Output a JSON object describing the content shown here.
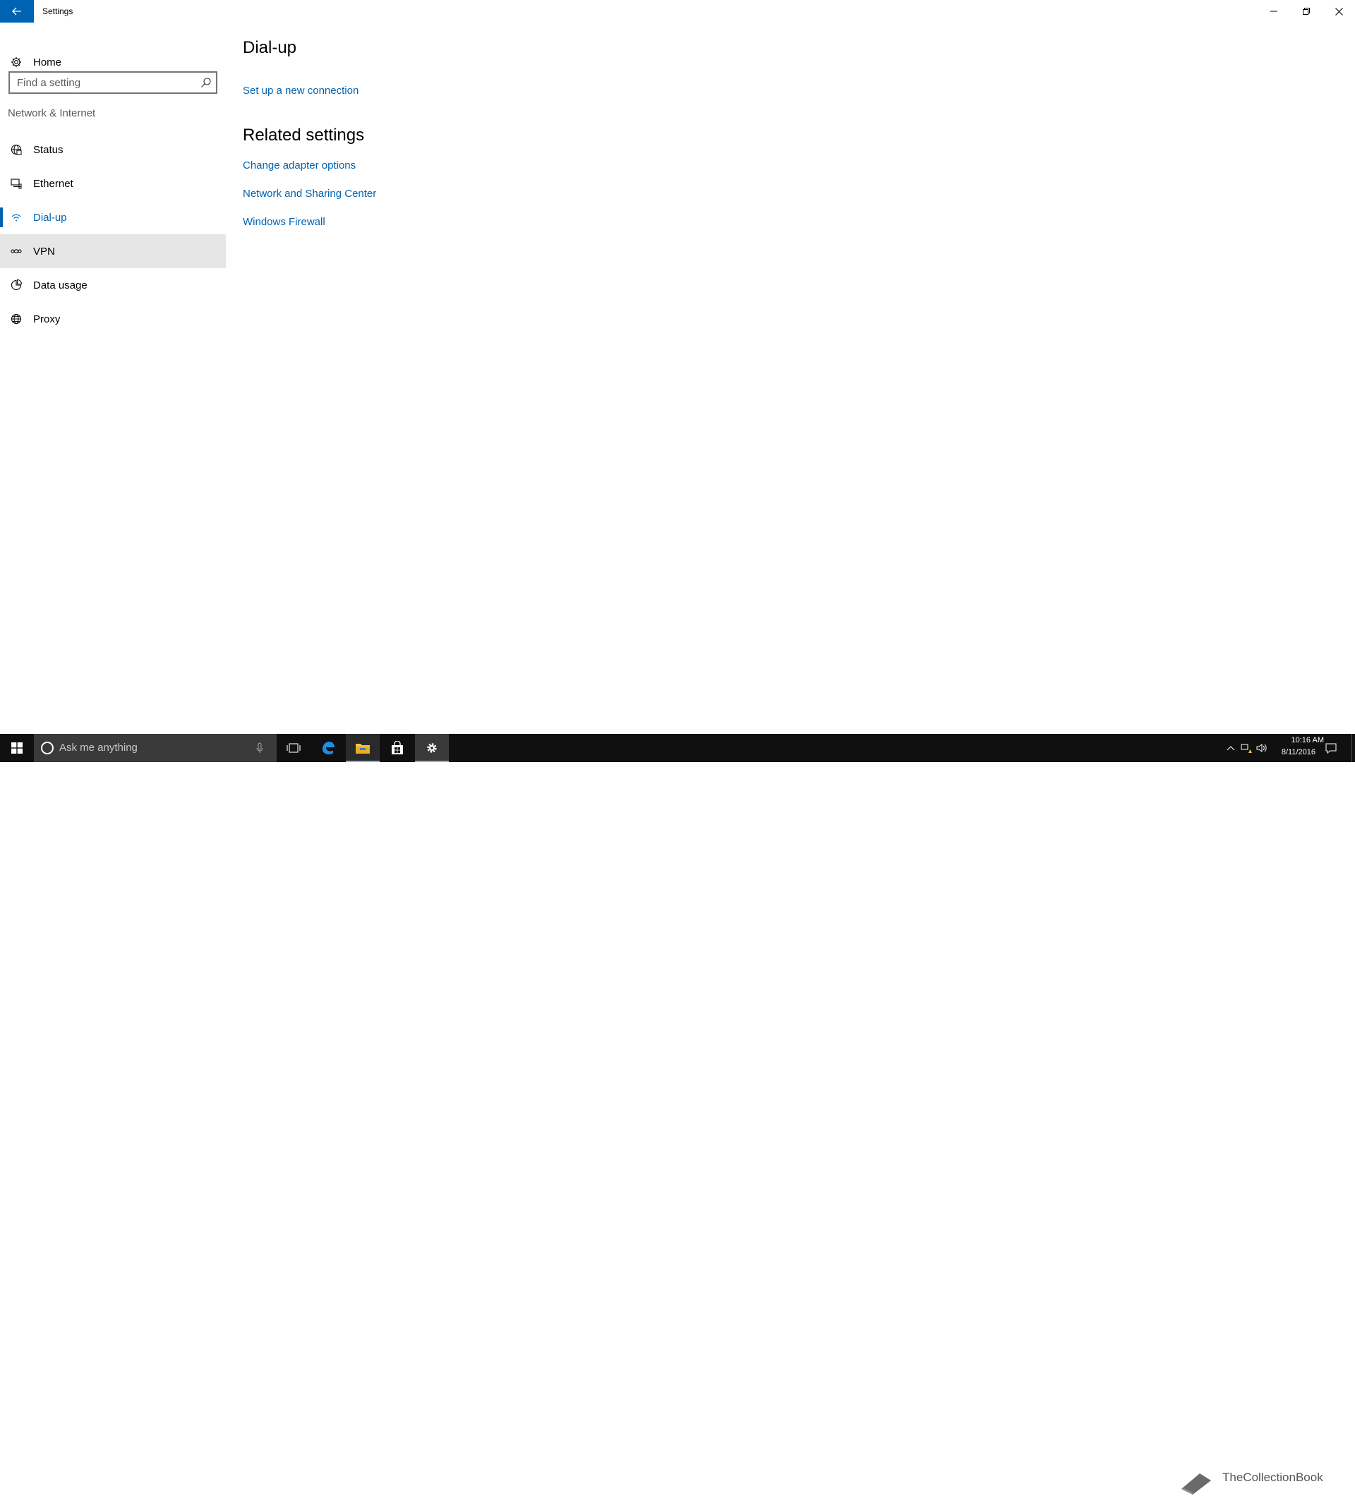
{
  "window": {
    "title": "Settings",
    "back_icon": "back-arrow-icon",
    "minimize_icon": "minimize-icon",
    "restore_icon": "restore-icon",
    "close_icon": "close-icon"
  },
  "sidebar": {
    "home_label": "Home",
    "home_icon": "gear-icon",
    "search_placeholder": "Find a setting",
    "search_value": "",
    "section_label": "Network & Internet",
    "items": [
      {
        "label": "Status",
        "icon": "globe-status-icon",
        "selected": false
      },
      {
        "label": "Ethernet",
        "icon": "ethernet-icon",
        "selected": false
      },
      {
        "label": "Dial-up",
        "icon": "dialup-icon",
        "selected": true
      },
      {
        "label": "VPN",
        "icon": "vpn-icon",
        "selected": false
      },
      {
        "label": "Data usage",
        "icon": "data-usage-icon",
        "selected": false
      },
      {
        "label": "Proxy",
        "icon": "globe-icon",
        "selected": false
      }
    ],
    "accent_color": "#0063b1"
  },
  "main": {
    "title": "Dial-up",
    "setup_link": "Set up a new connection",
    "related_title": "Related settings",
    "related_links": [
      "Change adapter options",
      "Network and Sharing Center",
      "Windows Firewall"
    ]
  },
  "taskbar": {
    "search_placeholder": "Ask me anything",
    "watermark": "TheCollectionBook",
    "time": "10:16 AM",
    "date": "8/11/2016"
  }
}
